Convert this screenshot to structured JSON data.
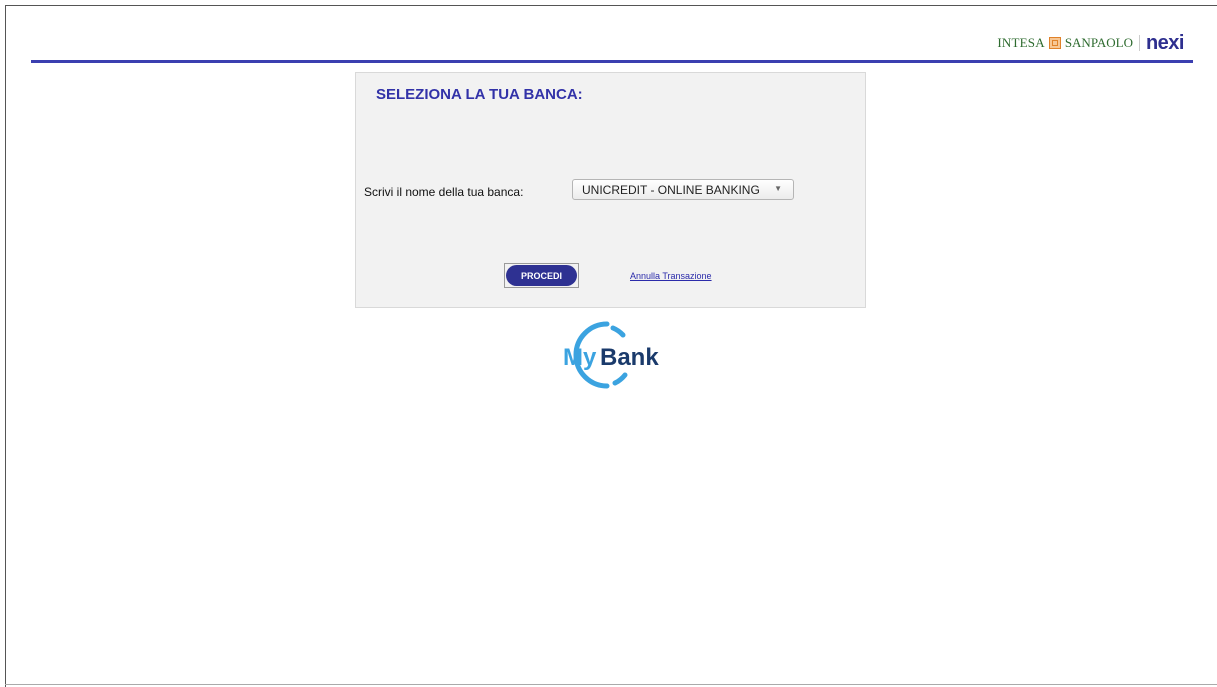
{
  "header": {
    "bank_brand": {
      "intesa": "INTESA",
      "sanpaolo": "SANPAOLO"
    },
    "partner_brand": "nexi"
  },
  "panel": {
    "title": "SELEZIONA LA TUA BANCA:",
    "field_label": "Scrivi il nome della tua banca:",
    "bank_select": {
      "selected": "UNICREDIT - ONLINE BANKING"
    },
    "proceed_label": "PROCEDI",
    "cancel_label": "Annulla Transazione"
  },
  "logo": {
    "my": "My",
    "bank": "Bank"
  },
  "icons": {
    "select_arrow": "chevron-down-icon",
    "isp_mark": "intesa-sanpaolo-mark-icon"
  },
  "colors": {
    "accent": "#3b3fb0",
    "button": "#2e3192",
    "title": "#3232a8",
    "mybank_blue": "#3ba3e0",
    "mybank_navy": "#1a3a6b"
  }
}
